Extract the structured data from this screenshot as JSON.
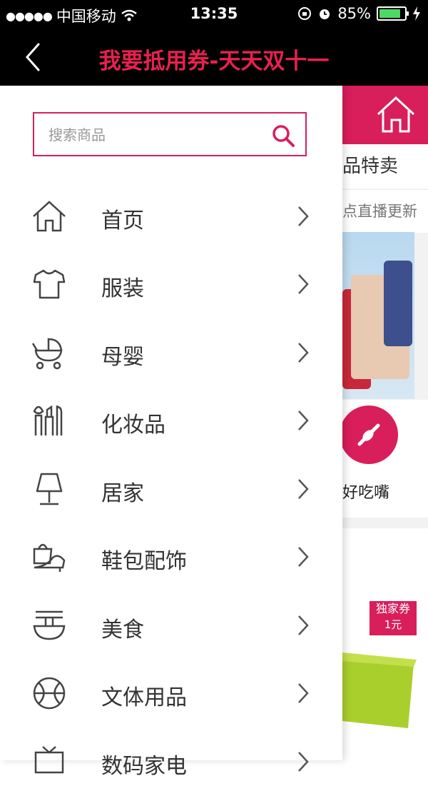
{
  "status_bar": {
    "carrier": "中国移动",
    "time": "13:35",
    "battery": "85%",
    "battery_level": 0.85,
    "icons": [
      "signal-dots-icon",
      "wifi-icon",
      "rotation-lock-icon",
      "alarm-icon",
      "battery-icon",
      "charging-icon"
    ]
  },
  "nav": {
    "title": "我要抵用券-天天双十一",
    "back_icon": "back-chevron-icon",
    "title_color": "#e8214f"
  },
  "search": {
    "placeholder": "搜索商品",
    "value": "",
    "icon": "search-icon",
    "border_color": "#d81e5b"
  },
  "menu": {
    "items": [
      {
        "label": "首页",
        "icon": "home-icon"
      },
      {
        "label": "服装",
        "icon": "tshirt-icon"
      },
      {
        "label": "母婴",
        "icon": "stroller-icon"
      },
      {
        "label": "化妆品",
        "icon": "cosmetics-icon"
      },
      {
        "label": "居家",
        "icon": "lamp-icon"
      },
      {
        "label": "鞋包配饰",
        "icon": "bag-shoe-icon"
      },
      {
        "label": "美食",
        "icon": "food-bowl-icon"
      },
      {
        "label": "文体用品",
        "icon": "ball-icon"
      },
      {
        "label": "数码家电",
        "icon": "tv-icon"
      }
    ]
  },
  "background_page": {
    "section_title": "品特卖",
    "live_text": "点直播更新",
    "food_label": "好吃嘴",
    "coupon_title": "独家券",
    "coupon_amount": "1元",
    "accent_color": "#d81e5b"
  }
}
